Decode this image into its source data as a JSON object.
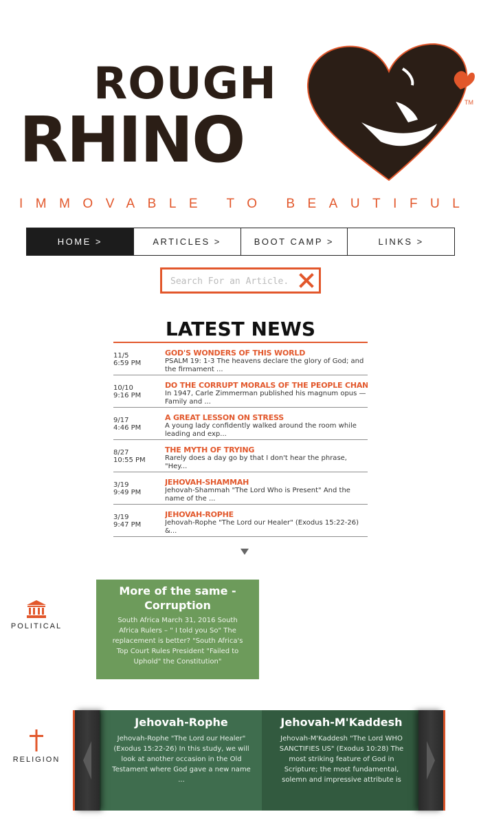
{
  "brand": {
    "name_line1": "ROUGH",
    "name_line2": "RHINO",
    "trademark": "TM",
    "tagline": "IMMOVABLE TO BEAUTIFUL",
    "accent_color": "#e2572b",
    "dark_color": "#2b1e16"
  },
  "nav": {
    "items": [
      {
        "label": "HOME >",
        "active": true
      },
      {
        "label": "ARTICLES >",
        "active": false
      },
      {
        "label": "BOOT CAMP >",
        "active": false
      },
      {
        "label": "LINKS >",
        "active": false
      }
    ]
  },
  "search": {
    "placeholder": "Search For an Article.",
    "clear_icon": "close-x-icon"
  },
  "news": {
    "title": "LATEST NEWS",
    "items": [
      {
        "date": "11/5",
        "time": "6:59 PM",
        "headline": "GOD'S WONDERS OF THIS WORLD",
        "excerpt": "PSALM 19: 1-3 The heavens declare the glory of God; and the firmament ..."
      },
      {
        "date": "10/10",
        "time": "9:16 PM",
        "headline": "DO THE CORRUPT MORALS OF THE PEOPLE CHANGE",
        "excerpt": "In 1947, Carle Zimmerman published his magnum opus — Family and ..."
      },
      {
        "date": "9/17",
        "time": "4:46 PM",
        "headline": "A GREAT LESSON ON STRESS",
        "excerpt": "A young lady confidently walked around the room while leading and exp..."
      },
      {
        "date": "8/27",
        "time": "10:55 PM",
        "headline": "THE MYTH OF TRYING",
        "excerpt": "Rarely does a day go by that I don't hear the phrase, \"Hey..."
      },
      {
        "date": "3/19",
        "time": "9:49 PM",
        "headline": "JEHOVAH-SHAMMAH",
        "excerpt": "Jehovah-Shammah \"The Lord Who is Present\"  And the name of the ..."
      },
      {
        "date": "3/19",
        "time": "9:47 PM",
        "headline": "JEHOVAH-ROPHE",
        "excerpt": "Jehovah-Rophe \"The Lord our Healer\"  (Exodus 15:22-26)  &..."
      }
    ]
  },
  "categories": {
    "political": {
      "label": "POLITICAL",
      "icon": "government-building-icon"
    },
    "religion": {
      "label": "RELIGION",
      "icon": "cross-icon"
    }
  },
  "political_card": {
    "title": "More of the same - Corruption",
    "excerpt": "South Africa March 31, 2016 South Africa Rulers – \" I told you So\" The replacement is better? \"South Africa's Top Court Rules President \"Failed to Uphold\" the Constitution\"",
    "color": "#6d9b5b"
  },
  "religion_slides": [
    {
      "title": "Jehovah-Rophe",
      "excerpt": "Jehovah-Rophe \"The Lord our Healer\"  (Exodus 15:22-26)          In this study, we will look at another occasion in the Old Testament where God gave a new name ..."
    },
    {
      "title": "Jehovah-M'Kaddesh",
      "excerpt": "Jehovah-M'Kaddesh \"The Lord WHO SANCTIFIES US\"  (Exodus 10:28)   The most striking feature of God in Scripture; the most fundamental, solemn and impressive attribute is"
    }
  ]
}
